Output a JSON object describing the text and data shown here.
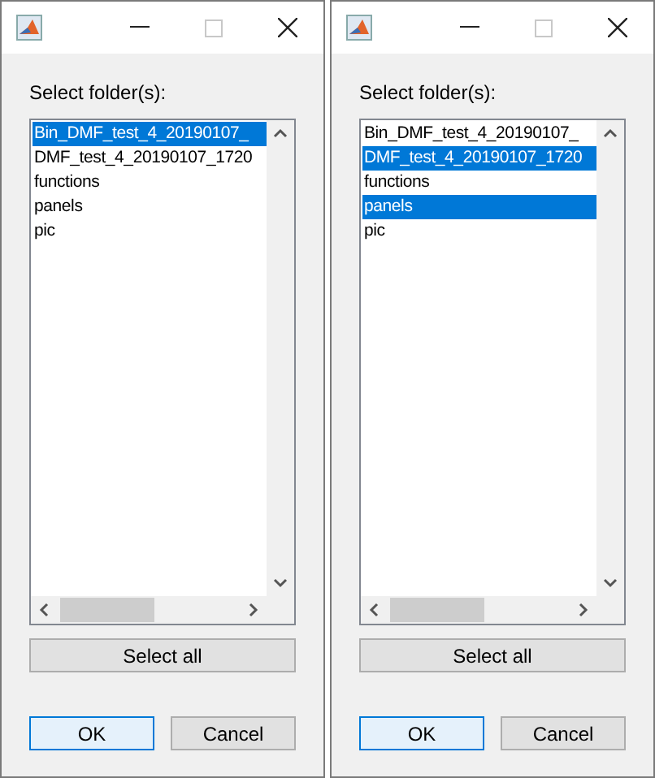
{
  "dialogs": [
    {
      "prompt": "Select folder(s):",
      "items": [
        {
          "label": "Bin_DMF_test_4_20190107_",
          "selected": true
        },
        {
          "label": "DMF_test_4_20190107_1720",
          "selected": false
        },
        {
          "label": "functions",
          "selected": false
        },
        {
          "label": "panels",
          "selected": false
        },
        {
          "label": "pic",
          "selected": false
        }
      ],
      "select_all": "Select all",
      "ok": "OK",
      "cancel": "Cancel"
    },
    {
      "prompt": "Select folder(s):",
      "items": [
        {
          "label": "Bin_DMF_test_4_20190107_",
          "selected": false
        },
        {
          "label": "DMF_test_4_20190107_1720",
          "selected": true
        },
        {
          "label": "functions",
          "selected": false
        },
        {
          "label": "panels",
          "selected": true
        },
        {
          "label": "pic",
          "selected": false
        }
      ],
      "select_all": "Select all",
      "ok": "OK",
      "cancel": "Cancel"
    }
  ]
}
